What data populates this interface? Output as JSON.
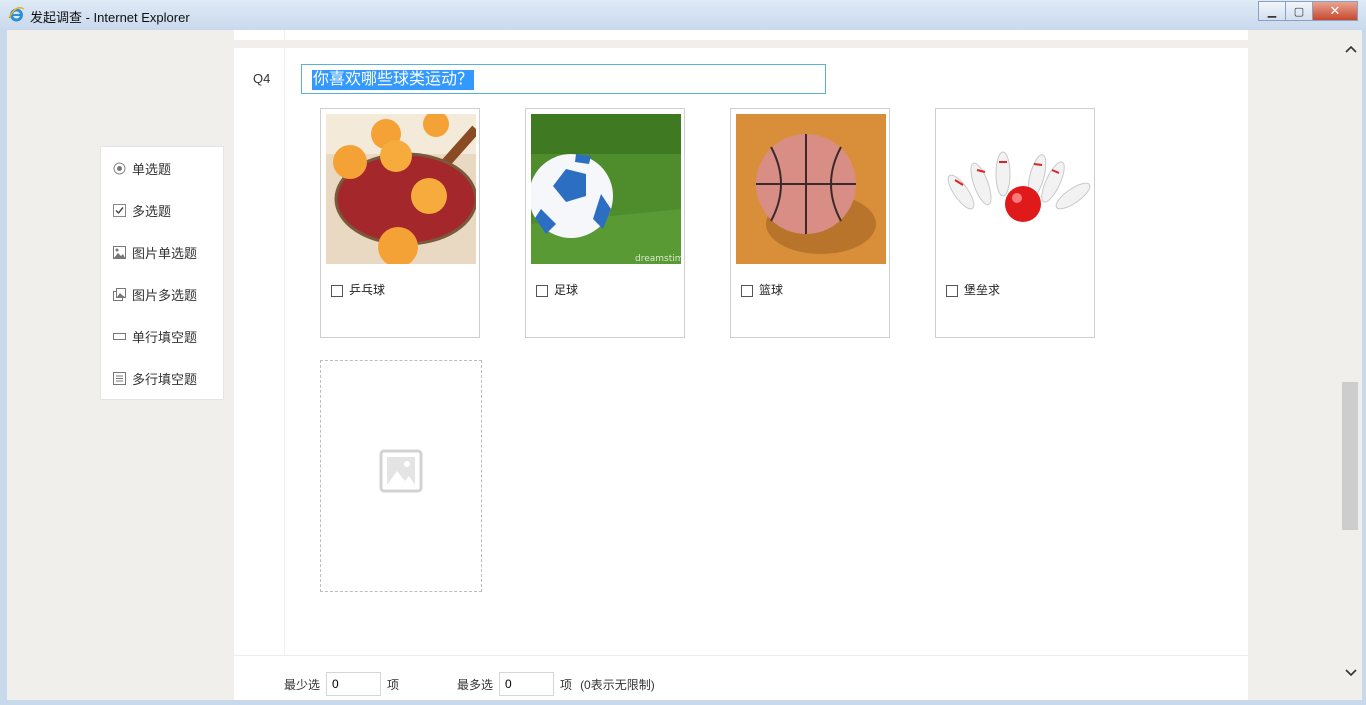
{
  "window": {
    "title": "发起调查 - Internet Explorer"
  },
  "toolbox": {
    "items": [
      {
        "label": "单选题",
        "icon": "radio-icon"
      },
      {
        "label": "多选题",
        "icon": "checkbox-icon"
      },
      {
        "label": "图片单选题",
        "icon": "image-icon"
      },
      {
        "label": "图片多选题",
        "icon": "image-multi-icon"
      },
      {
        "label": "单行填空题",
        "icon": "single-line-icon"
      },
      {
        "label": "多行填空题",
        "icon": "multi-line-icon"
      }
    ]
  },
  "question": {
    "number": "Q4",
    "title": "你喜欢哪些球类运动？",
    "options": [
      {
        "label": "乒乓球",
        "image": "ping-pong"
      },
      {
        "label": "足球",
        "image": "soccer"
      },
      {
        "label": "篮球",
        "image": "basketball"
      },
      {
        "label": "堡垒求",
        "image": "bowling"
      }
    ]
  },
  "limits": {
    "min_label": "最少选",
    "min_value": "0",
    "min_unit": "项",
    "max_label": "最多选",
    "max_value": "0",
    "max_unit": "项",
    "hint": "(0表示无限制)"
  },
  "colors": {
    "title_highlight": "#3399ff",
    "title_border": "#5bb1d8"
  }
}
